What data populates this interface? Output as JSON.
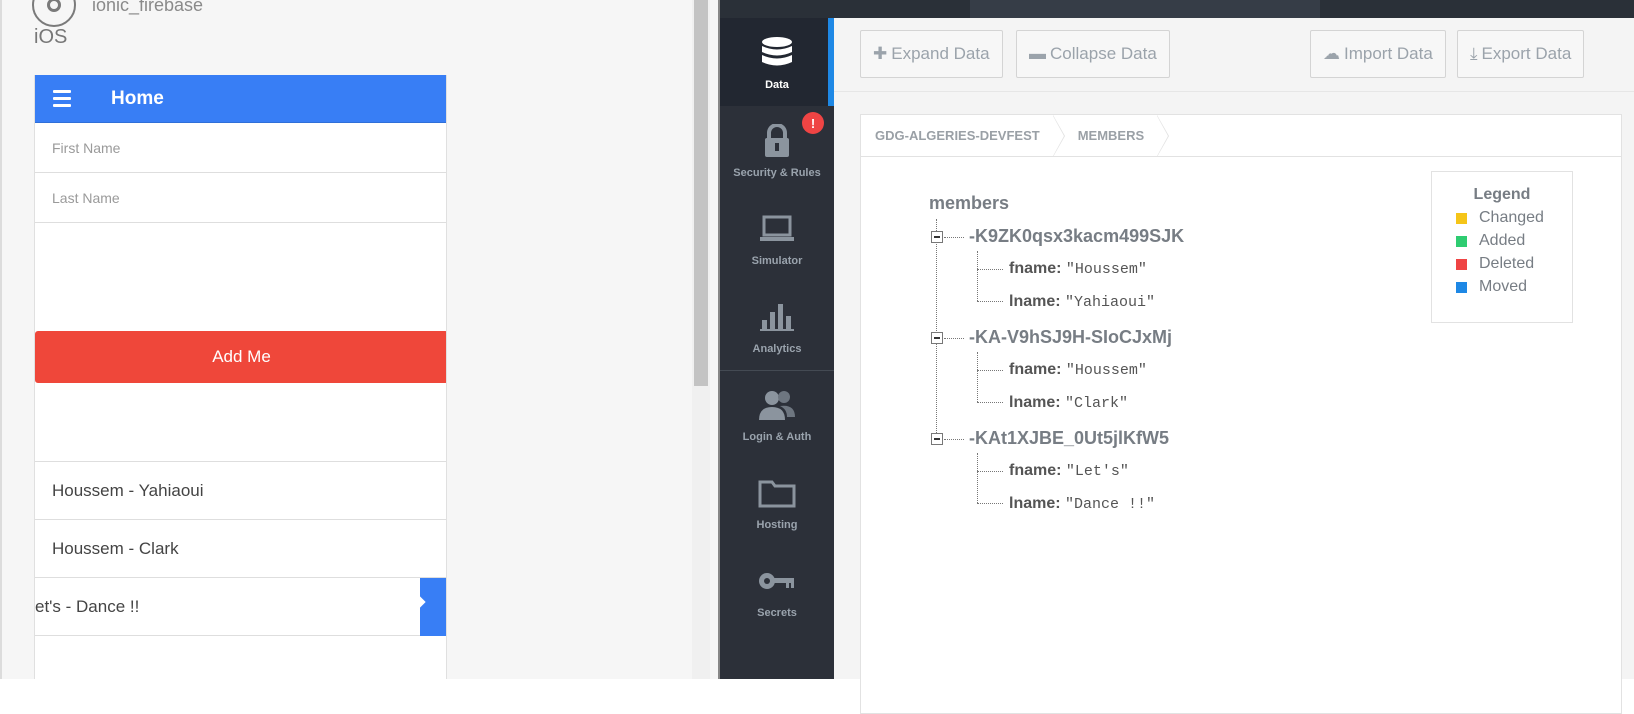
{
  "ionic_lab": {
    "app_name": "ionic_firebase",
    "platform": "iOS",
    "header_title": "Home",
    "first_name_placeholder": "First Name",
    "last_name_placeholder": "Last Name",
    "add_button_label": "Add Me",
    "members": [
      {
        "label": "Houssem - Yahiaoui"
      },
      {
        "label": "Houssem - Clark"
      },
      {
        "label": "et's - Dance !!"
      }
    ]
  },
  "firebase": {
    "nav": [
      {
        "label": "Data",
        "icon": "database-icon",
        "active": true
      },
      {
        "label": "Security & Rules",
        "icon": "lock-icon",
        "badge": "!"
      },
      {
        "label": "Simulator",
        "icon": "laptop-icon"
      },
      {
        "label": "Analytics",
        "icon": "bar-chart-icon"
      },
      {
        "label": "Login & Auth",
        "icon": "users-icon"
      },
      {
        "label": "Hosting",
        "icon": "folder-icon"
      },
      {
        "label": "Secrets",
        "icon": "key-icon"
      }
    ],
    "toolbar": {
      "expand": "Expand Data",
      "collapse": "Collapse Data",
      "import": "Import Data",
      "export": "Export Data"
    },
    "breadcrumb": [
      "GDG-ALGERIES-DEVFEST",
      "MEMBERS"
    ],
    "tree": {
      "root": "members",
      "nodes": [
        {
          "key": "-K9ZK0qsx3kacm499SJK",
          "fname_key": "fname:",
          "fname": "\"Houssem\"",
          "lname_key": "lname:",
          "lname": "\"Yahiaoui\""
        },
        {
          "key": "-KA-V9hSJ9H-SIoCJxMj",
          "fname_key": "fname:",
          "fname": "\"Houssem\"",
          "lname_key": "lname:",
          "lname": "\"Clark\""
        },
        {
          "key": "-KAt1XJBE_0Ut5jlKfW5",
          "fname_key": "fname:",
          "fname": "\"Let's\"",
          "lname_key": "lname:",
          "lname": "\"Dance !!\""
        }
      ]
    },
    "legend": {
      "title": "Legend",
      "items": [
        {
          "label": "Changed",
          "color": "#f5c518"
        },
        {
          "label": "Added",
          "color": "#2ecc71"
        },
        {
          "label": "Deleted",
          "color": "#ef4444"
        },
        {
          "label": "Moved",
          "color": "#1e88e5"
        }
      ]
    }
  }
}
